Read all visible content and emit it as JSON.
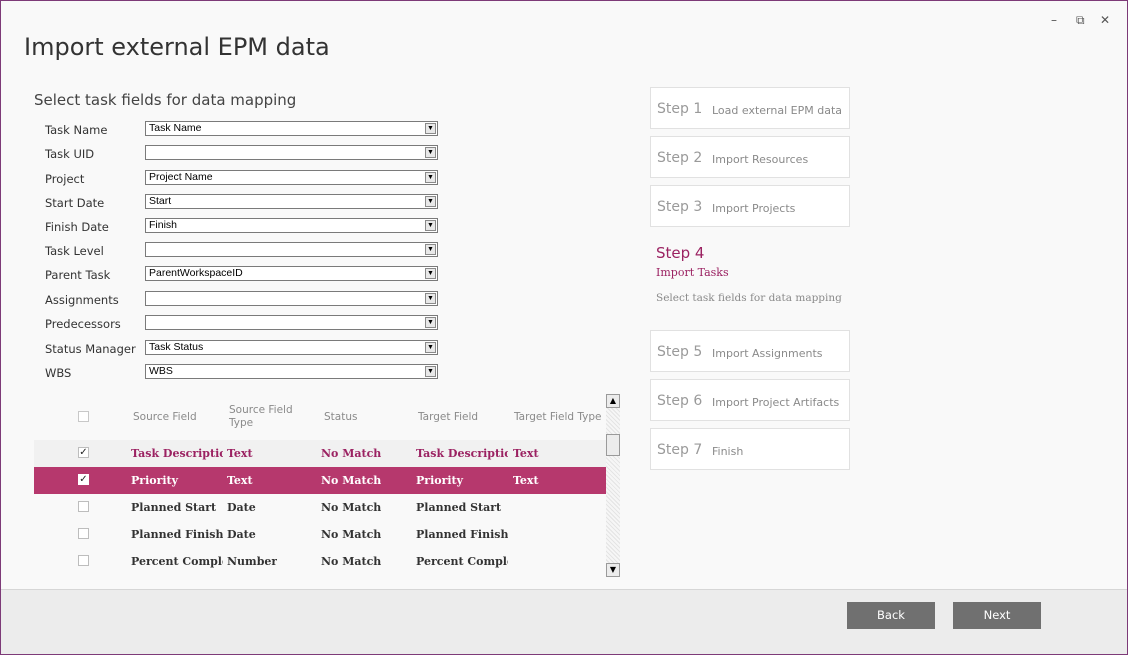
{
  "window": {
    "title": "Import external EPM data",
    "controls": {
      "minimize": "–",
      "restore": "⧉",
      "close": "✕"
    }
  },
  "form": {
    "heading": "Select task fields for data mapping",
    "fields": [
      {
        "label": "Task Name",
        "value": "Task Name"
      },
      {
        "label": "Task UID",
        "value": ""
      },
      {
        "label": "Project",
        "value": "Project Name"
      },
      {
        "label": "Start Date",
        "value": "Start"
      },
      {
        "label": "Finish Date",
        "value": "Finish"
      },
      {
        "label": "Task Level",
        "value": ""
      },
      {
        "label": "Parent Task",
        "value": "ParentWorkspaceID"
      },
      {
        "label": "Assignments",
        "value": ""
      },
      {
        "label": "Predecessors",
        "value": ""
      },
      {
        "label": "Status Manager",
        "value": "Task Status"
      },
      {
        "label": "WBS",
        "value": "WBS"
      }
    ]
  },
  "grid": {
    "headers": {
      "source_field": "Source Field",
      "source_field_type": "Source Field Type",
      "status": "Status",
      "target_field": "Target Field",
      "target_field_type": "Target Field Type"
    },
    "rows": [
      {
        "checked": true,
        "source": "Task Description",
        "type": "Text",
        "status": "No Match",
        "target": "Task Description",
        "target_type": "Text"
      },
      {
        "checked": true,
        "source": "Priority",
        "type": "Text",
        "status": "No Match",
        "target": "Priority",
        "target_type": "Text"
      },
      {
        "checked": false,
        "source": "Planned Start",
        "type": "Date",
        "status": "No Match",
        "target": "Planned Start",
        "target_type": ""
      },
      {
        "checked": false,
        "source": "Planned Finish",
        "type": "Date",
        "status": "No Match",
        "target": "Planned Finish",
        "target_type": ""
      },
      {
        "checked": false,
        "source": "Percent Comple...",
        "type": "Number",
        "status": "No Match",
        "target": "Percent Comple...",
        "target_type": ""
      }
    ]
  },
  "steps": [
    {
      "num": "Step 1",
      "name": "Load external EPM data"
    },
    {
      "num": "Step 2",
      "name": "Import Resources"
    },
    {
      "num": "Step 3",
      "name": "Import Projects"
    },
    {
      "num": "Step 4",
      "name": "Import Tasks",
      "desc": "Select task fields for data mapping"
    },
    {
      "num": "Step 5",
      "name": "Import Assignments"
    },
    {
      "num": "Step 6",
      "name": "Import Project Artifacts"
    },
    {
      "num": "Step 7",
      "name": "Finish"
    }
  ],
  "buttons": {
    "back": "Back",
    "next": "Next"
  },
  "colors": {
    "accent": "#b6386d",
    "accent_text": "#9b2262",
    "button": "#707070"
  }
}
